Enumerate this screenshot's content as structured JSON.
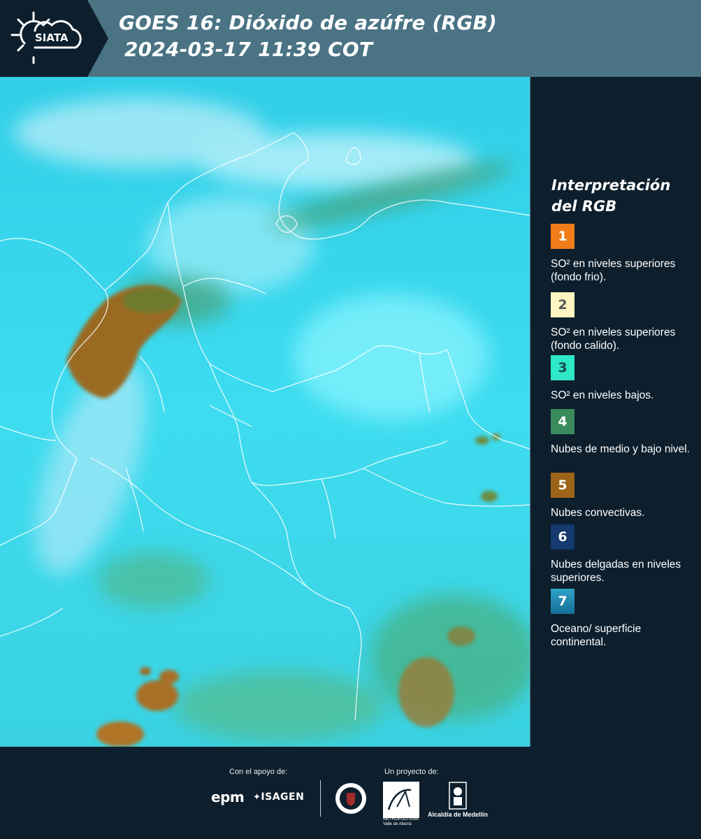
{
  "header": {
    "logo_text": "SIATA",
    "title_line1": "GOES 16: Dióxido de azúfre (RGB)",
    "title_line2": "2024-03-17 11:39 COT"
  },
  "legend": {
    "title_line1": "Interpretación",
    "title_line2": "del RGB",
    "items": [
      {
        "num": "1",
        "color": "#f07d1a",
        "text": "SO² en niveles superiores (fondo frio)."
      },
      {
        "num": "2",
        "color": "#fff5c2",
        "text": "SO² en niveles superiores (fondo calido)."
      },
      {
        "num": "3",
        "color": "#2ee8c8",
        "text": "SO² en niveles bajos."
      },
      {
        "num": "4",
        "color": "#3a8a5c",
        "text": "Nubes de medio y bajo nivel."
      },
      {
        "num": "5",
        "color": "#9c6418",
        "text": "Nubes convectivas."
      },
      {
        "num": "6",
        "color": "#143a6e",
        "text": "Nubes delgadas en niveles superiores."
      },
      {
        "num": "7",
        "color": "#1e8fb8",
        "text": "Oceano/ superficie continental."
      }
    ]
  },
  "footer": {
    "support_label": "Con el apoyo de:",
    "project_label": "Un proyecto de:",
    "epm": "epm",
    "isagen": "ISAGEN",
    "area_caption": "METROPOLITANA Valle de Aburrá",
    "alcaldia": "Alcaldía de Medellín"
  },
  "colors": {
    "header_bg": "#4a7384",
    "page_bg": "#0d1f2d",
    "map_sky": "#35d6ee",
    "convective_cloud": "#9c6a1e",
    "mid_low_cloud": "#3a8a5c"
  }
}
